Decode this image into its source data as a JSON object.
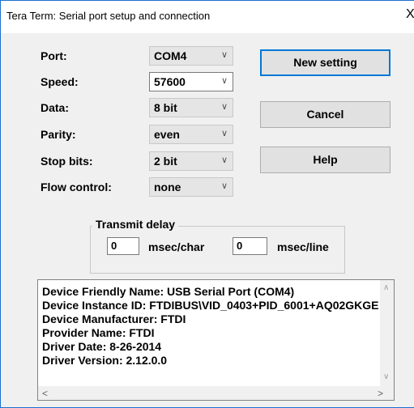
{
  "window": {
    "title": "Tera Term: Serial port setup and connection",
    "close_glyph": "X"
  },
  "fields": [
    {
      "label": "Port:",
      "value": "COM4"
    },
    {
      "label": "Speed:",
      "value": "57600"
    },
    {
      "label": "Data:",
      "value": "8 bit"
    },
    {
      "label": "Parity:",
      "value": "even"
    },
    {
      "label": "Stop bits:",
      "value": "2 bit"
    },
    {
      "label": "Flow control:",
      "value": "none"
    }
  ],
  "buttons": {
    "new_setting": "New setting",
    "cancel": "Cancel",
    "help": "Help"
  },
  "transmit_delay": {
    "title": "Transmit delay",
    "char_value": "0",
    "char_unit": "msec/char",
    "line_value": "0",
    "line_unit": "msec/line"
  },
  "device_info": [
    "Device Friendly Name: USB Serial Port (COM4)",
    "Device Instance ID: FTDIBUS\\VID_0403+PID_6001+AQ02GKGE",
    "Device Manufacturer: FTDI",
    "Provider Name: FTDI",
    "Driver Date: 8-26-2014",
    "Driver Version: 2.12.0.0"
  ],
  "colors": {
    "accent": "#0078d7",
    "window_border": "#1a6fd0",
    "dialog_bg": "#f0f0f0"
  }
}
